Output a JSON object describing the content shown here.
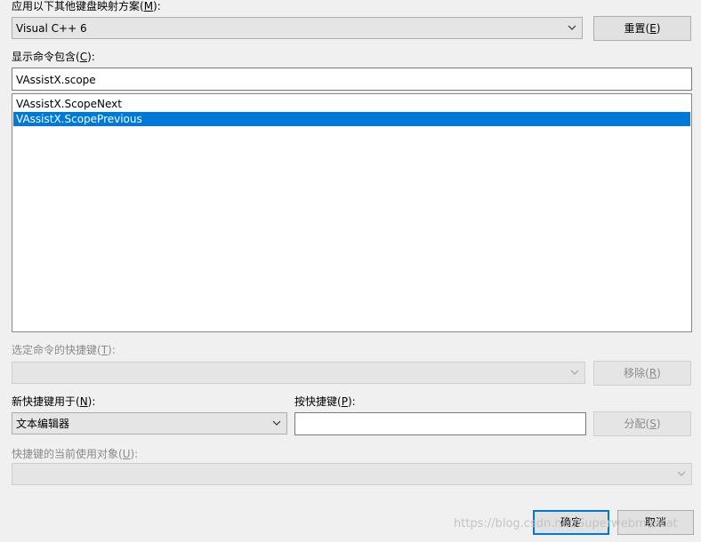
{
  "keyboard_scheme": {
    "label": "应用以下其他键盘映射方案(",
    "label_key": "M",
    "label_end": "):",
    "value": "Visual C++ 6",
    "reset_button": "重置(",
    "reset_key": "E",
    "reset_end": ")"
  },
  "show_commands": {
    "label": "显示命令包含(",
    "label_key": "C",
    "label_end": "):",
    "value": "VAssistX.scope"
  },
  "command_list": {
    "items": [
      "VAssistX.ScopeNext",
      "VAssistX.ScopePrevious"
    ],
    "selected_index": 1
  },
  "selected_shortcut": {
    "label": "选定命令的快捷键(",
    "label_key": "T",
    "label_end": "):",
    "value": "",
    "remove_button": "移除(",
    "remove_key": "R",
    "remove_end": ")"
  },
  "new_shortcut": {
    "label": "新快捷键用于(",
    "label_key": "N",
    "label_end": "):",
    "value": "文本编辑器"
  },
  "press_shortcut": {
    "label": "按快捷键(",
    "label_key": "P",
    "label_end": "):",
    "value": "",
    "assign_button": "分配(",
    "assign_key": "S",
    "assign_end": ")"
  },
  "currently_used_by": {
    "label": "快捷键的当前使用对象(",
    "label_key": "U",
    "label_end": "):",
    "value": ""
  },
  "footer": {
    "ok": "确定",
    "cancel": "取消"
  },
  "watermark": "https://blog.csdn.net/Superwebmascat",
  "colors": {
    "selection": "#0078d7",
    "window_bg": "#f0f0f0",
    "disabled_text": "#8a8a8a"
  }
}
